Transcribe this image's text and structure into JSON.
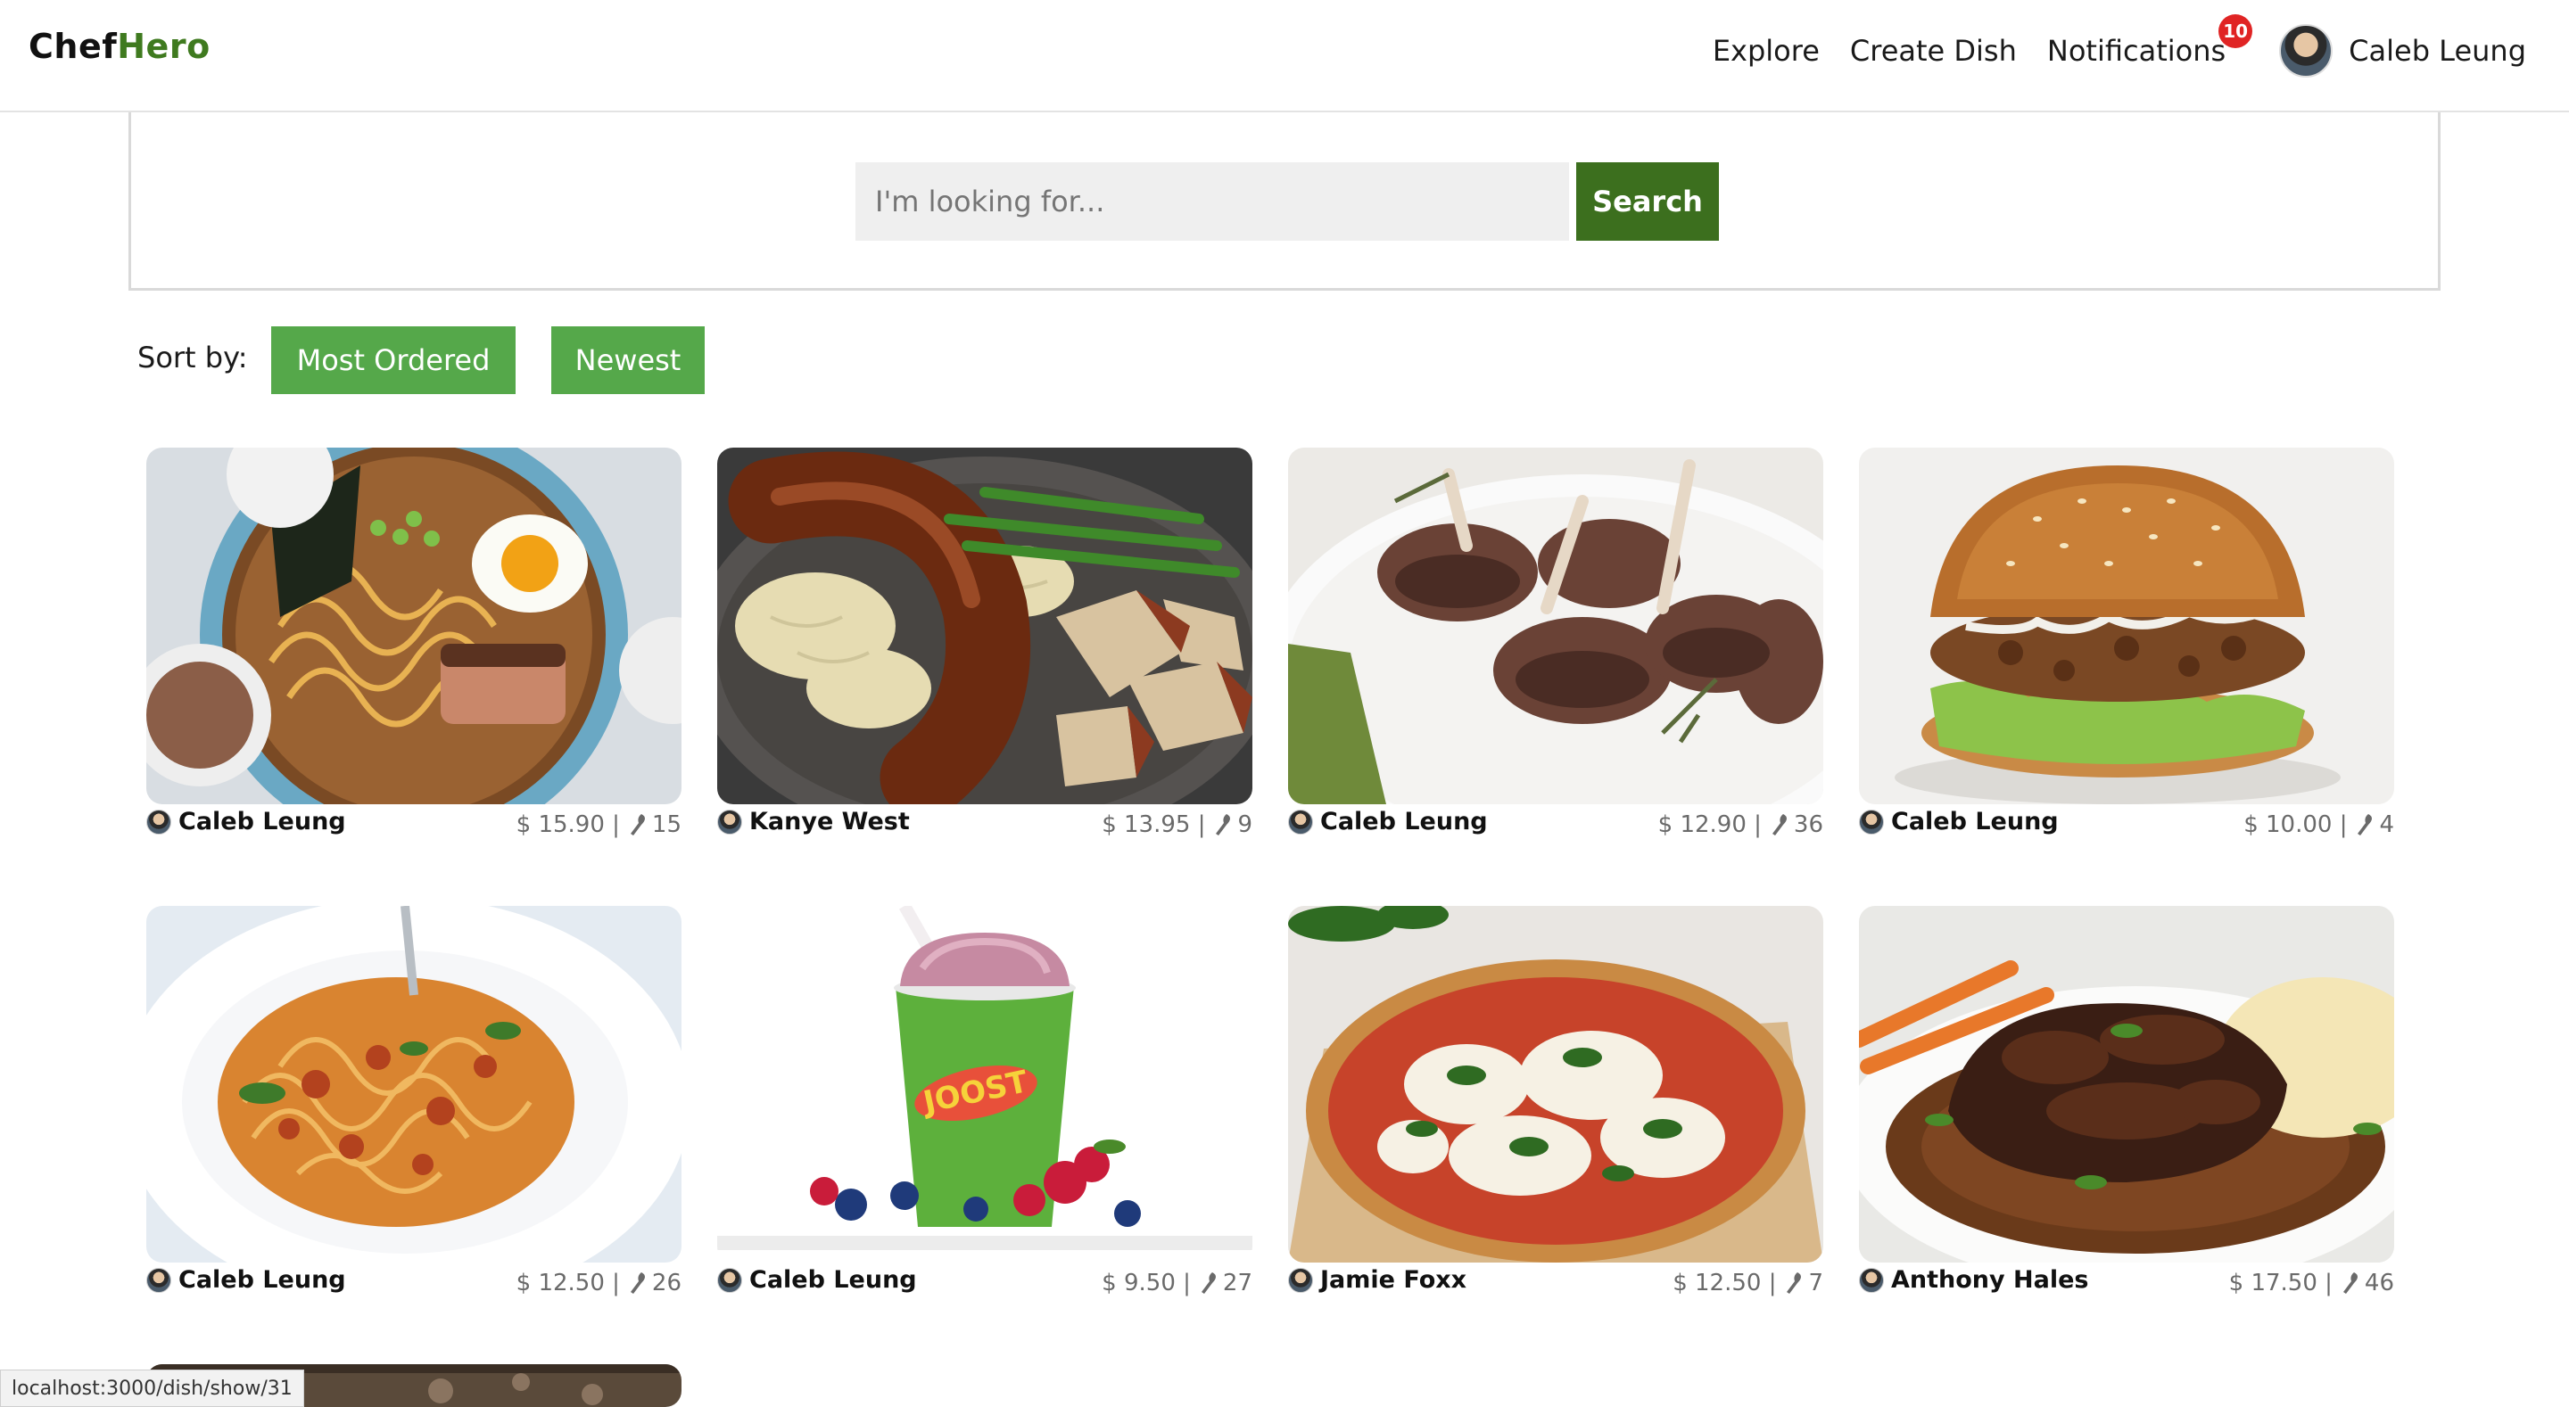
{
  "brand": {
    "part1": "Chef",
    "part2": "Hero"
  },
  "nav": {
    "explore": "Explore",
    "create_dish": "Create Dish",
    "notifications": "Notifications",
    "notifications_count": "10",
    "user_name": "Caleb Leung"
  },
  "search": {
    "placeholder": "I'm looking for...",
    "button": "Search"
  },
  "sort": {
    "label": "Sort by:",
    "most_ordered": "Most Ordered",
    "newest": "Newest"
  },
  "dishes": [
    {
      "author": "Caleb Leung",
      "price": "$ 15.90 |",
      "orders": "15",
      "image": "ramen"
    },
    {
      "author": "Kanye West",
      "price": "$ 13.95 |",
      "orders": "9",
      "image": "sausage"
    },
    {
      "author": "Caleb Leung",
      "price": "$ 12.90 |",
      "orders": "36",
      "image": "lamb"
    },
    {
      "author": "Caleb Leung",
      "price": "$ 10.00 |",
      "orders": "4",
      "image": "burger"
    },
    {
      "author": "Caleb Leung",
      "price": "$ 12.50 |",
      "orders": "26",
      "image": "spaghetti"
    },
    {
      "author": "Caleb Leung",
      "price": "$ 9.50 |",
      "orders": "27",
      "image": "smoothie"
    },
    {
      "author": "Jamie Foxx",
      "price": "$ 12.50 |",
      "orders": "7",
      "image": "pizza"
    },
    {
      "author": "Anthony Hales",
      "price": "$ 17.50 |",
      "orders": "46",
      "image": "beef"
    }
  ],
  "smoothie_cup_text": "JOOST",
  "status_bar": "localhost:3000/dish/show/31",
  "colors": {
    "brand_green": "#3f7a1f",
    "search_button": "#3c6f1e",
    "sort_button": "#55a84a",
    "badge": "#e02424"
  }
}
